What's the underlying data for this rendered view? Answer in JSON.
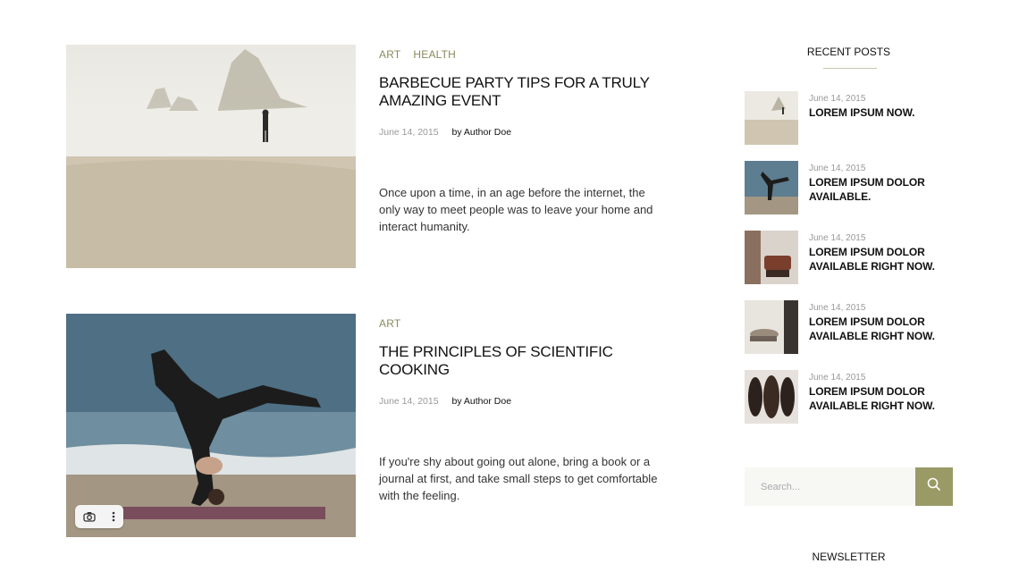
{
  "posts": [
    {
      "categories": [
        "ART",
        "HEALTH"
      ],
      "title": "BARBECUE PARTY TIPS FOR A TRULY AMAZING EVENT",
      "date": "June 14, 2015",
      "author": "by Author Doe",
      "excerpt": "Once upon a time, in an age before the internet, the only way to meet people was to leave your home and interact humanity."
    },
    {
      "categories": [
        "ART"
      ],
      "title": "THE PRINCIPLES OF SCIENTIFIC COOKING",
      "date": "June 14, 2015",
      "author": "by Author Doe",
      "excerpt": "If you're shy about going out alone, bring a book or a journal at first, and take small steps to get comfortable with the feeling."
    }
  ],
  "image_tools": {
    "camera_icon": "camera-icon",
    "more_icon": "more-vertical-icon"
  },
  "sidebar": {
    "recent_posts_heading": "RECENT POSTS",
    "recent_posts": [
      {
        "date": "June 14, 2015",
        "title": "LOREM IPSUM NOW."
      },
      {
        "date": "June 14, 2015",
        "title": "LOREM IPSUM DOLOR AVAILABLE."
      },
      {
        "date": "June 14, 2015",
        "title": "LOREM IPSUM DOLOR AVAILABLE RIGHT NOW."
      },
      {
        "date": "June 14, 2015",
        "title": "LOREM IPSUM DOLOR AVAILABLE RIGHT NOW."
      },
      {
        "date": "June 14, 2015",
        "title": "LOREM IPSUM DOLOR AVAILABLE RIGHT NOW."
      }
    ],
    "search_placeholder": "Search...",
    "search_icon": "search-icon",
    "newsletter_heading": "NEWSLETTER"
  },
  "colors": {
    "accent": "#9a9a66",
    "category": "#8a8a5c",
    "date": "#999999"
  }
}
